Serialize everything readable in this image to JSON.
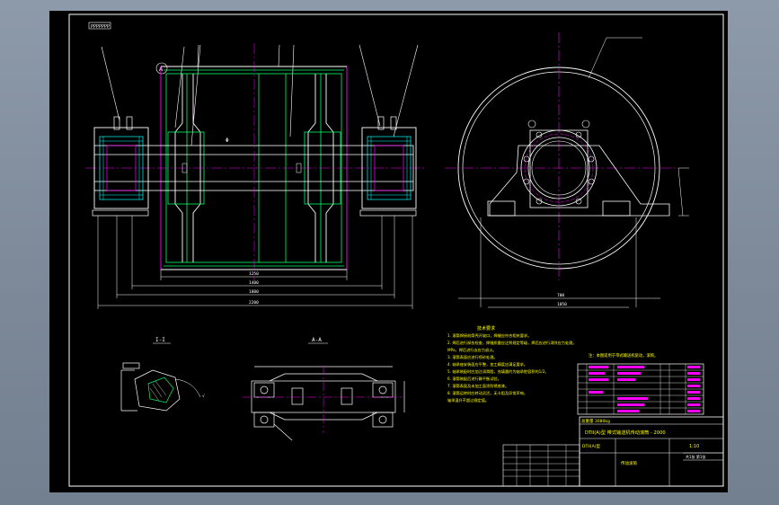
{
  "drawing": {
    "corner_stamp": "PPPPPPP",
    "section_a_label": "I-I",
    "section_b_label": "A-A",
    "balloon_text": "A",
    "tech_title": "技术要求",
    "tech_notes": [
      "1. 滚筒焊接前筒壳开坡口，焊缝应符合相关要求。",
      "2. 焊后进行探伤检查，焊缝质量应达到规定等级，焊后应进行消除应力处理。",
      "   MPa，焊后进行去应力退火。",
      "3. 滚筒表面应进行喷砂处理。",
      "4. 轴承座安装面应平整，加工精度应满足要求。",
      "5. 轴承装配时应加注润滑脂，充填量约为轴承腔容积的1/2。",
      "6. 滚筒装配后进行静平衡试验。",
      "7. 滚筒表面及未加工面涂防锈底漆。",
      "8. 滚筒运转时应转动灵活，无卡阻及异常声响，",
      "   轴承温升不超过规定值。"
    ],
    "bom_note": "注：本图适用于带式输送机驱动，滚筒。",
    "weight_label": "总重量 3080kg",
    "title_block_name": "DTII(A)型  带式输送机传动滚筒 - 2000",
    "title_block_code": "DTII(A)型",
    "title_block_desc": "传动滚筒",
    "scale_note": "1:10",
    "sheet_note": "共1张 第1张",
    "dim_marks": [
      "1250",
      "1400",
      "1800",
      "2200",
      "700",
      "1050"
    ]
  }
}
